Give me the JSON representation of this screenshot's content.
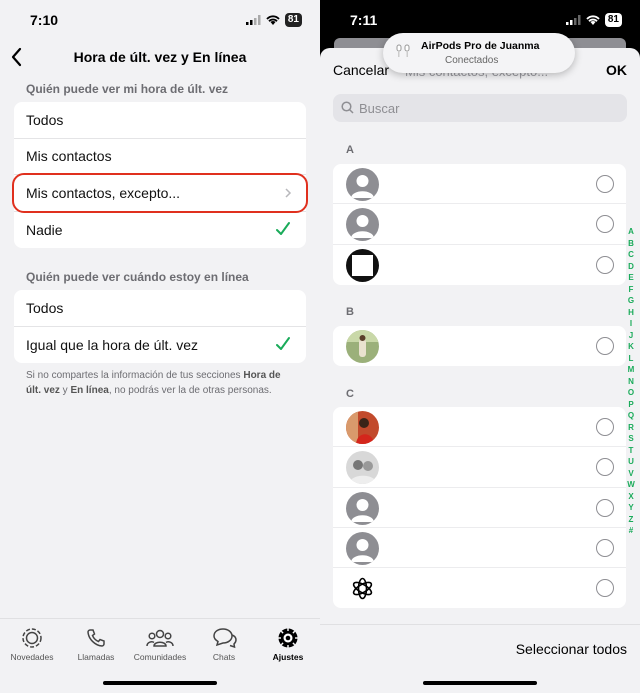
{
  "left": {
    "status": {
      "time": "7:10",
      "battery": "81"
    },
    "header": {
      "title": "Hora de últ. vez y En línea"
    },
    "section1": {
      "title": "Quién puede ver mi hora de últ. vez",
      "options": [
        "Todos",
        "Mis contactos",
        "Mis contactos, excepto...",
        "Nadie"
      ]
    },
    "section2": {
      "title": "Quién puede ver cuándo estoy en línea",
      "options": [
        "Todos",
        "Igual que la hora de últ. vez"
      ]
    },
    "note": {
      "p1": "Si no compartes la información de tus secciones ",
      "b1": "Hora de últ. vez",
      "p2": " y ",
      "b2": "En línea",
      "p3": ", no podrás ver la de otras personas."
    },
    "tabs": [
      "Novedades",
      "Llamadas",
      "Comunidades",
      "Chats",
      "Ajustes"
    ],
    "accent": "#1aab5a",
    "highlight_color": "#e0301e"
  },
  "right": {
    "status": {
      "time": "7:11",
      "battery": "81"
    },
    "cancel": "Cancelar",
    "ok": "OK",
    "ghost_title": "Mis contactos, excepto...",
    "toast": {
      "title": "AirPods Pro de Juanma",
      "subtitle": "Conectados"
    },
    "search_placeholder": "Buscar",
    "sections": [
      "A",
      "B",
      "C"
    ],
    "index": [
      "A",
      "B",
      "C",
      "D",
      "E",
      "F",
      "G",
      "H",
      "I",
      "J",
      "K",
      "L",
      "M",
      "N",
      "O",
      "P",
      "Q",
      "R",
      "S",
      "T",
      "U",
      "V",
      "W",
      "X",
      "Y",
      "Z",
      "#"
    ],
    "select_all": "Seleccionar todos"
  }
}
